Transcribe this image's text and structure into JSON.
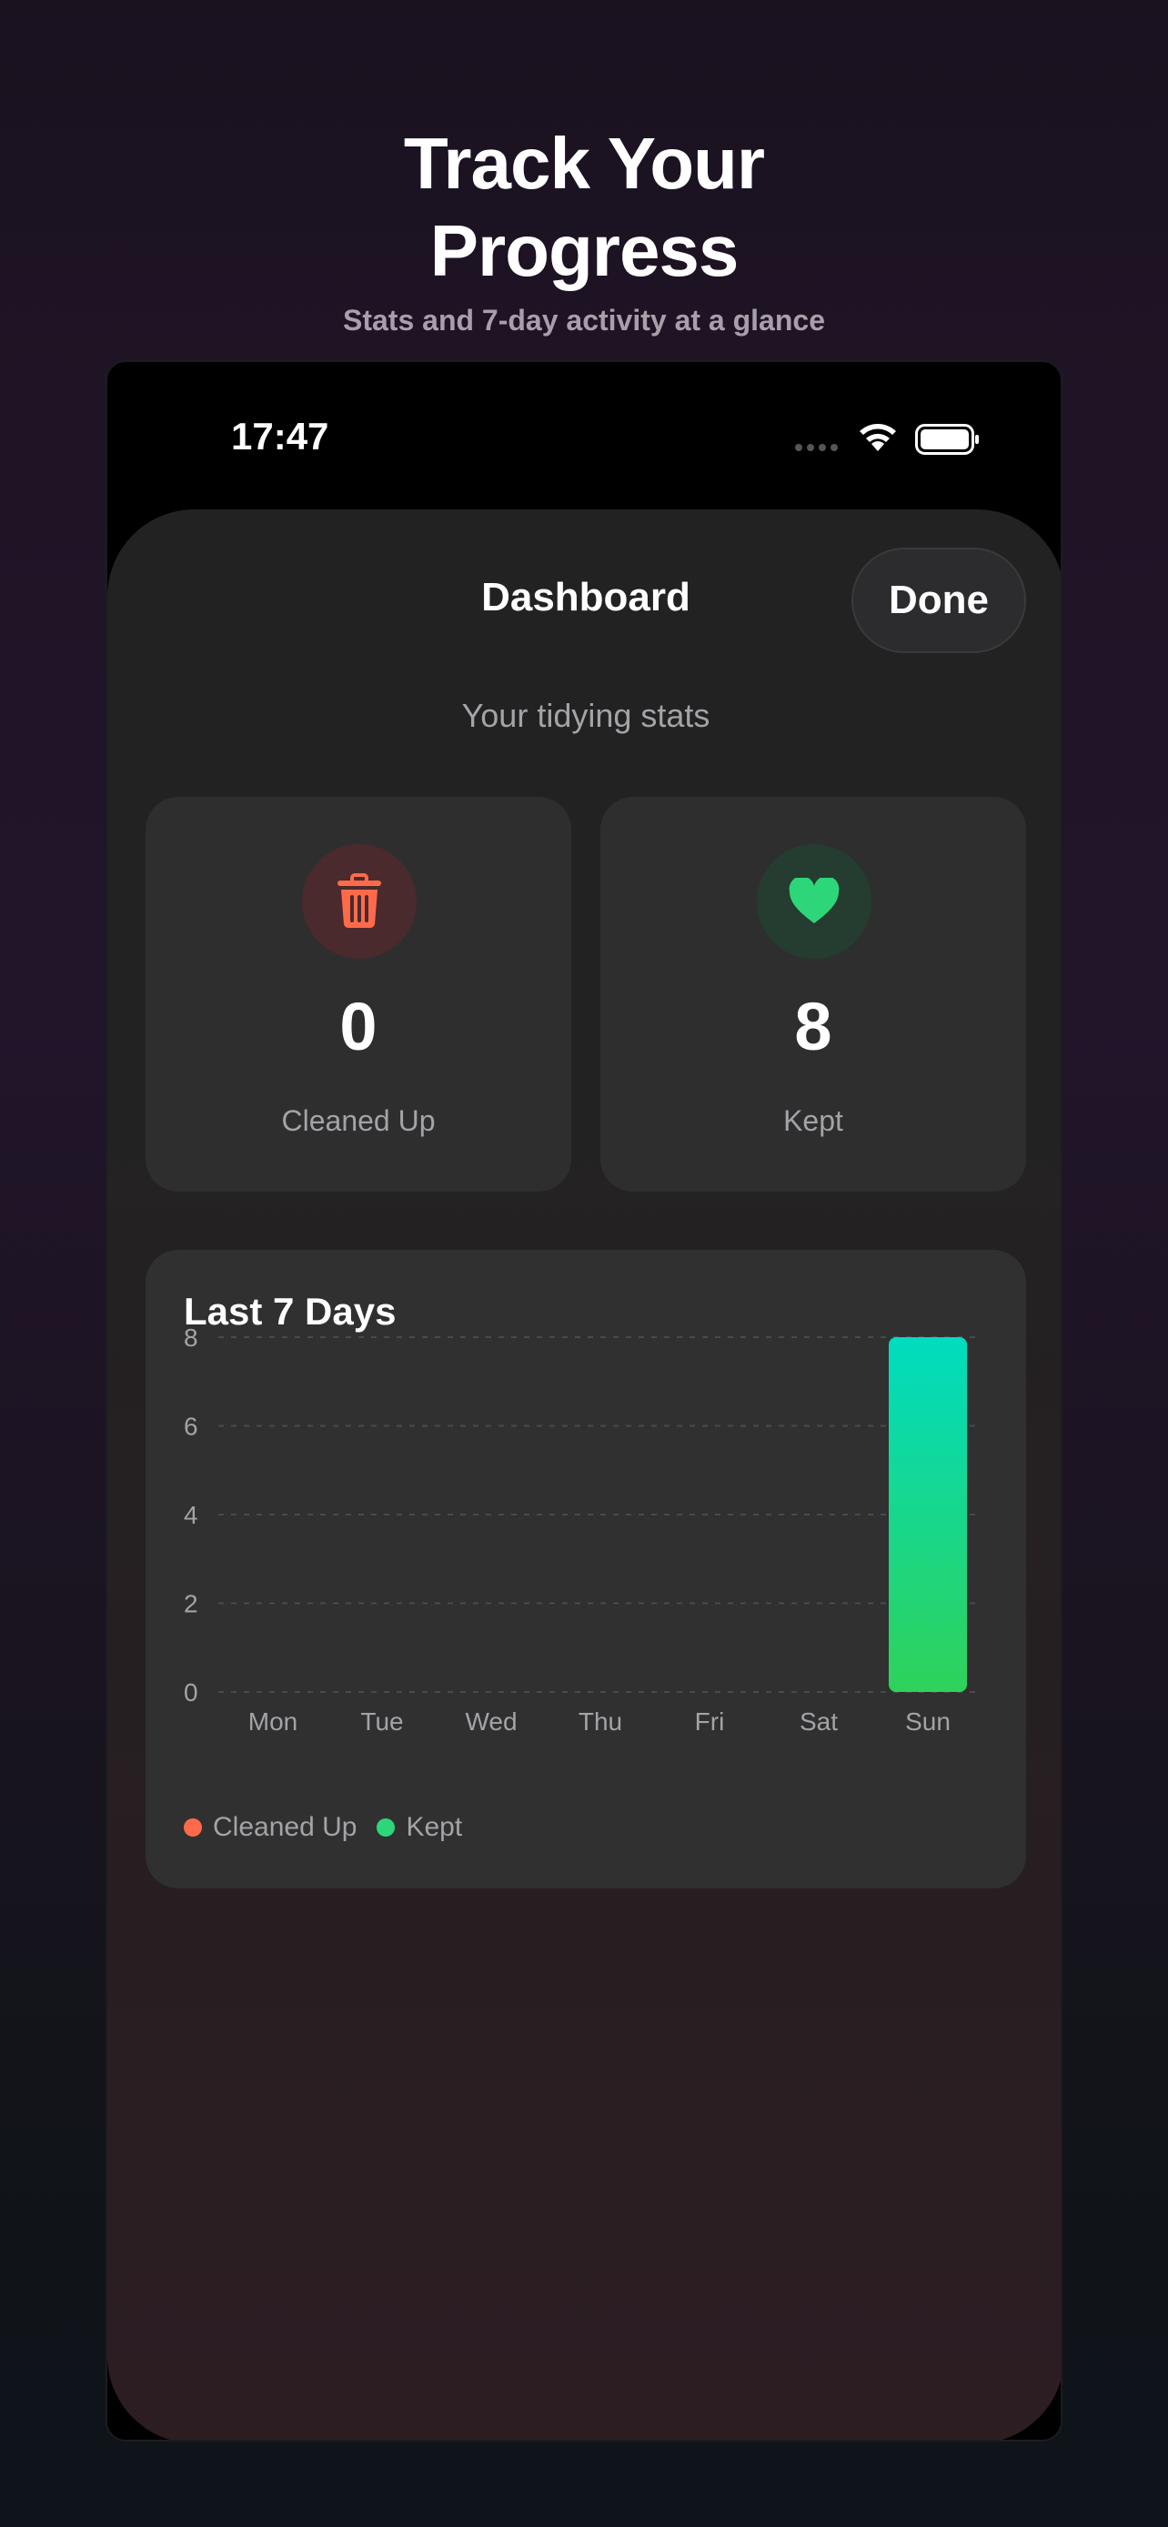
{
  "promo": {
    "title_line1": "Track Your",
    "title_line2": "Progress",
    "subtitle": "Stats and 7-day activity at a glance"
  },
  "status_bar": {
    "time": "17:47"
  },
  "sheet": {
    "title": "Dashboard",
    "done_label": "Done",
    "subtitle": "Your tidying stats"
  },
  "stats": {
    "cleaned": {
      "value": "0",
      "label": "Cleaned Up",
      "icon": "trash-icon",
      "color": "#ff6b4a"
    },
    "kept": {
      "value": "8",
      "label": "Kept",
      "icon": "heart-icon",
      "color": "#2ed67a"
    }
  },
  "chart_data": {
    "type": "bar",
    "title": "Last 7 Days",
    "categories": [
      "Mon",
      "Tue",
      "Wed",
      "Thu",
      "Fri",
      "Sat",
      "Sun"
    ],
    "series": [
      {
        "name": "Cleaned Up",
        "values": [
          0,
          0,
          0,
          0,
          0,
          0,
          0
        ],
        "color": "#ff6b4a"
      },
      {
        "name": "Kept",
        "values": [
          0,
          0,
          0,
          0,
          0,
          0,
          8
        ],
        "color": "#2ed67a"
      }
    ],
    "ylim": [
      0,
      8
    ],
    "yticks": [
      0,
      2,
      4,
      6,
      8
    ],
    "grid": true,
    "legend": "bottom-left"
  }
}
